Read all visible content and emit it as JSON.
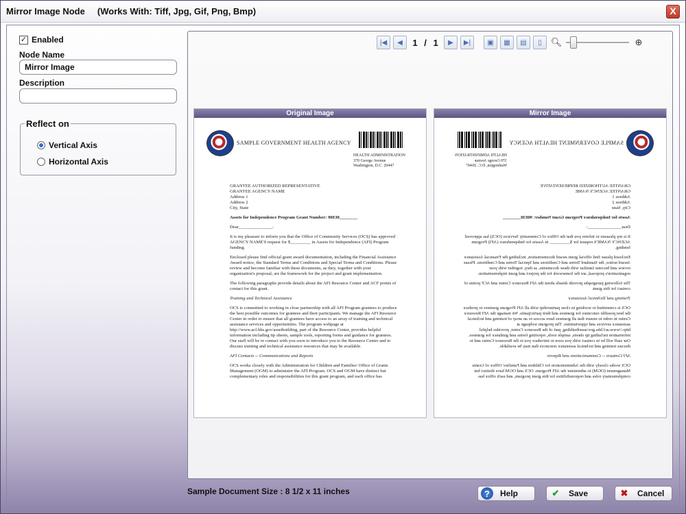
{
  "window": {
    "title": "Mirror Image Node     (Works With: Tiff, Jpg, Gif, Png, Bmp)",
    "close_label": "X"
  },
  "settings": {
    "enabled_label": "Enabled",
    "enabled_checked": true,
    "node_name_label": "Node Name",
    "node_name_value": "Mirror Image",
    "description_label": "Description",
    "description_value": "",
    "reflect_group_title": "Reflect on",
    "options": [
      {
        "label": "Vertical Axis",
        "selected": true
      },
      {
        "label": "Horizontal Axis",
        "selected": false
      }
    ]
  },
  "viewer": {
    "page_current": "1",
    "page_sep": "/",
    "page_total": "1",
    "icons": [
      "first-page-icon",
      "prev-page-icon",
      "next-page-icon",
      "last-page-icon",
      "image-icon",
      "fit-width-icon",
      "fit-page-icon",
      "actual-size-icon",
      "zoom-out-icon",
      "zoom-in-icon"
    ],
    "original_header": "Original Image",
    "mirror_header": "Mirror Image"
  },
  "document": {
    "agency": "SAMPLE GOVERNMENT HEALTH AGENCY",
    "address": [
      "HEALTH ADMINISTRATION",
      "370 George Avenue",
      "Washington, D.C. 20447"
    ],
    "recipient": [
      "GRANTEE AUTHORIZED REPRESENTATIVE",
      "GRANTEE AGENCY NAME",
      "Address 1",
      "Address 2",
      "City, State"
    ],
    "grant_line": "Assets for Independence Program Grant Number: 90EI0________",
    "dear": "Dear_______________:",
    "p1": "It is my pleasure to inform you that the Office of Community Services (OCS) has approved AGENCY NAME'S request for $_________ in Assets for Independence (AFI) Program funding.",
    "p2": "Enclosed please find official grant award documentation, including the Financial Assistance Award notice, the Standard Terms and Conditions and Special Terms and Conditions. Please review and become familiar with these documents, as they, together with your organization's proposal, are the framework for the project and grant implementation.",
    "p3": "The following paragraphs provide details about the AFI Resource Center and ACF points of contact for this grant.",
    "h1": "Training and Technical Assistance",
    "p4": "OCS is committed to working in close partnership with all AFI Program grantees to produce the best possible outcomes for grantees and their participants. We manage the AFI Resource Center in order to ensure that all grantees have access to an array of training and technical assistance services and opportunities. The program webpage at http://www.acf.hhs.gov/assetbuilding, part of the Resource Center, provides helpful information including tip sheets, sample tools, reporting forms and guidance for grantees. Our staff will be in contact with you soon to introduce you to the Resource Center and to discuss training and technical assistance resources that may be available.",
    "h2": "AFI Contacts -- Communications and Reports",
    "p5": "OCS works closely with the Administration for Children and Families' Office of Grants Management (OGM) to administer the AFI Program. OCS and OGM have distinct but complementary roles and responsibilities for this grant program, and each office has"
  },
  "footer": {
    "doc_size": "Sample Document Size : 8 1/2 x 11 inches",
    "help_label": "Help",
    "save_label": "Save",
    "cancel_label": "Cancel"
  }
}
